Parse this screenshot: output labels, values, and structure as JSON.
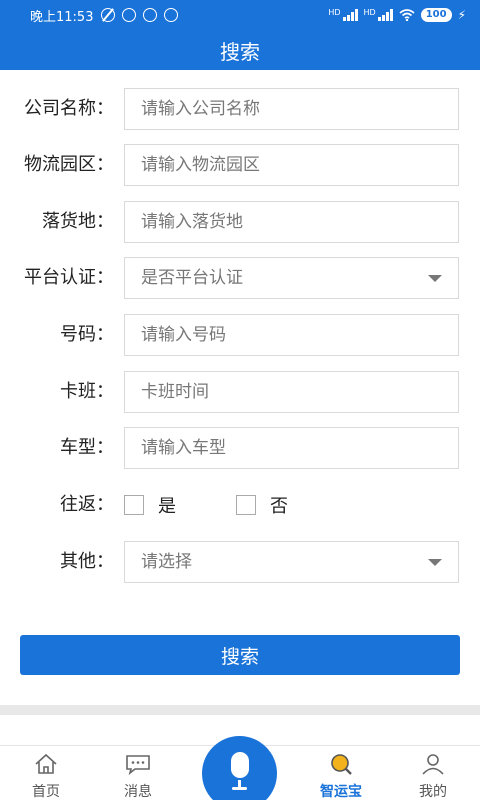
{
  "status_bar": {
    "time": "晚上11:53",
    "signal1": "HD",
    "signal2": "HD",
    "battery": "100"
  },
  "header": {
    "title": "搜索"
  },
  "form": {
    "company": {
      "label": "公司名称：",
      "placeholder": "请输入公司名称"
    },
    "park": {
      "label": "物流园区：",
      "placeholder": "请输入物流园区"
    },
    "destination": {
      "label": "落货地：",
      "placeholder": "请输入落货地"
    },
    "platform_cert": {
      "label": "平台认证：",
      "value": "是否平台认证"
    },
    "number": {
      "label": "号码：",
      "placeholder": "请输入号码"
    },
    "shift": {
      "label": "卡班：",
      "placeholder": "卡班时间"
    },
    "vehicle": {
      "label": "车型：",
      "placeholder": "请输入车型"
    },
    "round_trip": {
      "label": "往返：",
      "options": [
        "是",
        "否"
      ]
    },
    "other": {
      "label": "其他：",
      "value": "请选择"
    }
  },
  "search_button": {
    "label": "搜索"
  },
  "bottom_nav": {
    "items": [
      {
        "label": "首页",
        "icon": "home-icon"
      },
      {
        "label": "消息",
        "icon": "message-icon"
      },
      {
        "label": "",
        "icon": "mic-icon"
      },
      {
        "label": "智运宝",
        "icon": "search-icon"
      },
      {
        "label": "我的",
        "icon": "user-icon"
      }
    ]
  },
  "colors": {
    "primary": "#1a73d9",
    "border": "#d9d9d9",
    "text": "#222222",
    "placeholder": "#777777"
  }
}
